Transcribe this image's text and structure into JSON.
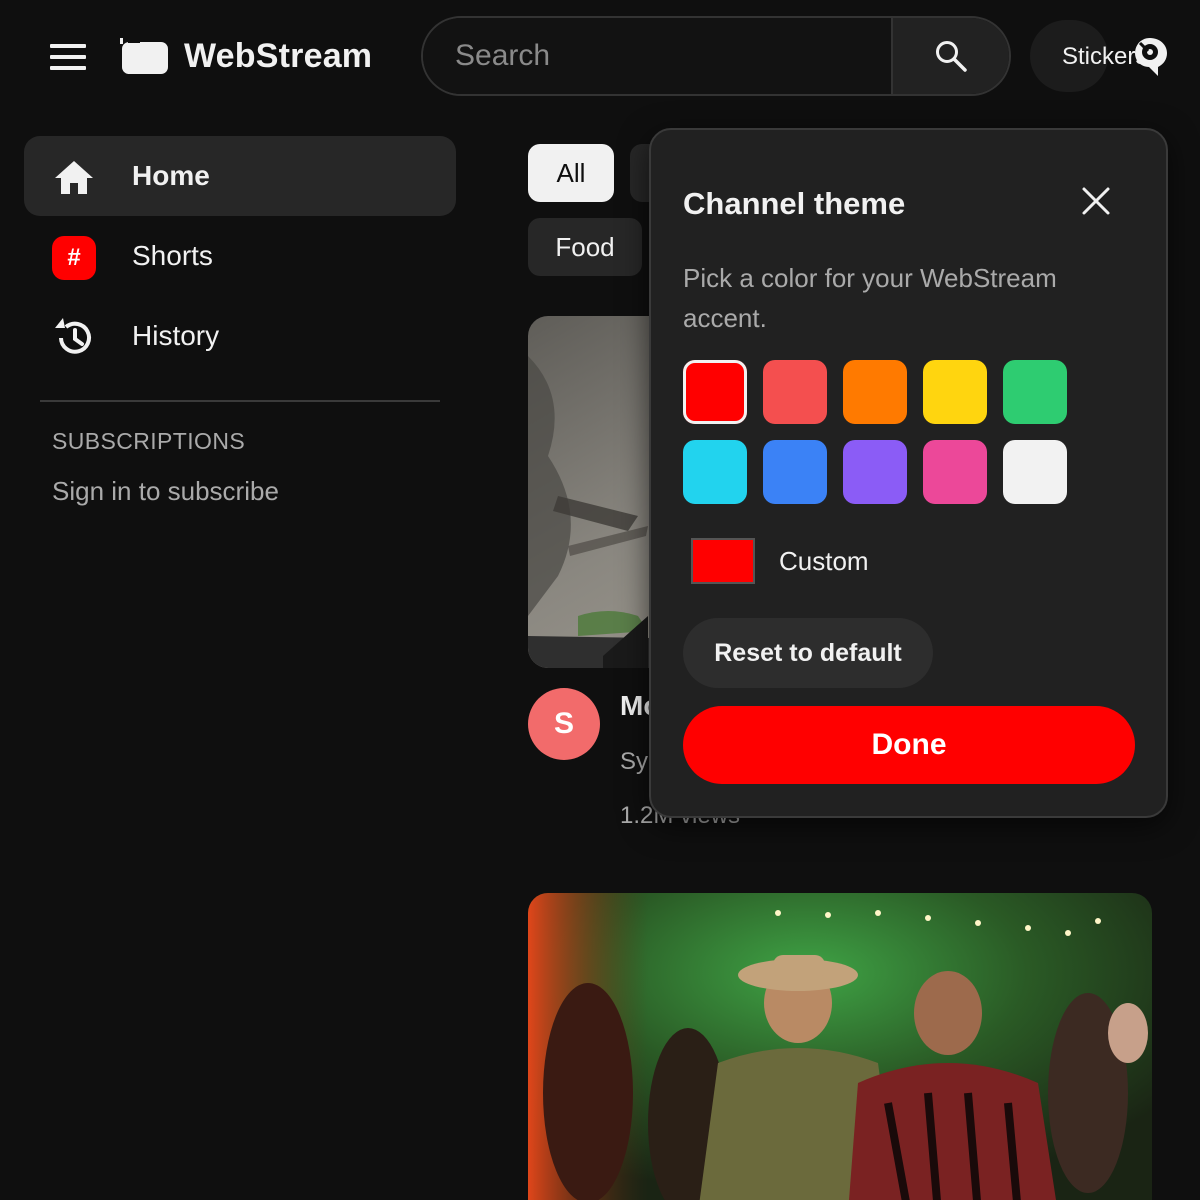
{
  "header": {
    "logo_text": "WebStream",
    "search": {
      "placeholder": "Search"
    },
    "stickers_label": "Stickers",
    "menu_icon": "hamburger-menu-icon",
    "search_icon": "search-icon",
    "sticker_icon": "sticker-icon"
  },
  "sidebar": {
    "items": [
      {
        "label": "Home",
        "icon": "home-icon",
        "active": true
      },
      {
        "label": "Shorts",
        "icon": "shorts-icon",
        "badge": "#"
      },
      {
        "label": "History",
        "icon": "history-icon"
      }
    ],
    "subscriptions_title": "SUBSCRIPTIONS",
    "sign_in_text": "Sign in to subscribe"
  },
  "chips": [
    {
      "label": "All",
      "active": true
    },
    {
      "label": "Food"
    }
  ],
  "videos": [
    {
      "avatar_letter": "S",
      "avatar_color": "#f26b6b",
      "title": "Mo",
      "channel": "Sy",
      "views": "1.2M views"
    }
  ],
  "theme_dialog": {
    "title": "Channel theme",
    "description": "Pick a color for your WebStream accent.",
    "swatches": [
      "#ff0000",
      "#f44f4f",
      "#ff7a00",
      "#ffd50f",
      "#2ecc71",
      "#22d3ee",
      "#3b82f6",
      "#8b5cf6",
      "#ec4899",
      "#f2f2f2"
    ],
    "selected_color": "#ff0000",
    "custom_label": "Custom",
    "custom_color": "#ff0000",
    "reset_label": "Reset to default",
    "done_label": "Done",
    "close_icon": "close-icon"
  },
  "colors": {
    "accent": "#ff0000",
    "background": "#0f0f0f",
    "surface": "#212121"
  }
}
